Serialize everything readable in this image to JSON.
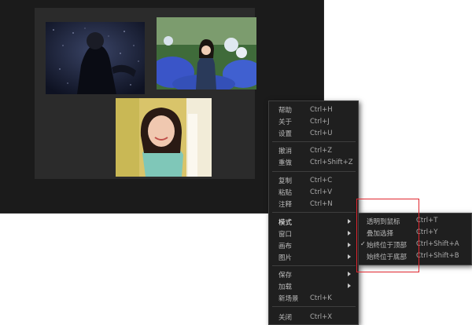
{
  "context_menu": {
    "items": [
      {
        "label": "帮助",
        "shortcut": "Ctrl+H"
      },
      {
        "label": "关于",
        "shortcut": "Ctrl+J"
      },
      {
        "label": "设置",
        "shortcut": "Ctrl+U"
      },
      {
        "label": "撤消",
        "shortcut": "Ctrl+Z"
      },
      {
        "label": "重做",
        "shortcut": "Ctrl+Shift+Z"
      },
      {
        "label": "复制",
        "shortcut": "Ctrl+C"
      },
      {
        "label": "粘贴",
        "shortcut": "Ctrl+V"
      },
      {
        "label": "注释",
        "shortcut": "Ctrl+N"
      },
      {
        "label": "模式"
      },
      {
        "label": "窗口"
      },
      {
        "label": "画布"
      },
      {
        "label": "图片"
      },
      {
        "label": "保存"
      },
      {
        "label": "加载"
      },
      {
        "label": "新场景",
        "shortcut": "Ctrl+K"
      },
      {
        "label": "关闭",
        "shortcut": "Ctrl+X"
      }
    ]
  },
  "submenu": {
    "items": [
      {
        "label": "透明到鼠标",
        "shortcut": "Ctrl+T",
        "checked": false
      },
      {
        "label": "叠加选择",
        "shortcut": "Ctrl+Y",
        "checked": false
      },
      {
        "label": "始终位于顶部",
        "shortcut": "Ctrl+Shift+A",
        "checked": true
      },
      {
        "label": "始终位于底部",
        "shortcut": "Ctrl+Shift+B",
        "checked": false
      }
    ],
    "check_glyph": "✓"
  },
  "colors": {
    "window_bg": "#1b1b1b",
    "canvas_bg": "#2b2b2b",
    "menu_bg": "#1f1f1f",
    "highlight": "#e0262e"
  },
  "icons": [
    "chevron-right-icon",
    "check-icon"
  ]
}
